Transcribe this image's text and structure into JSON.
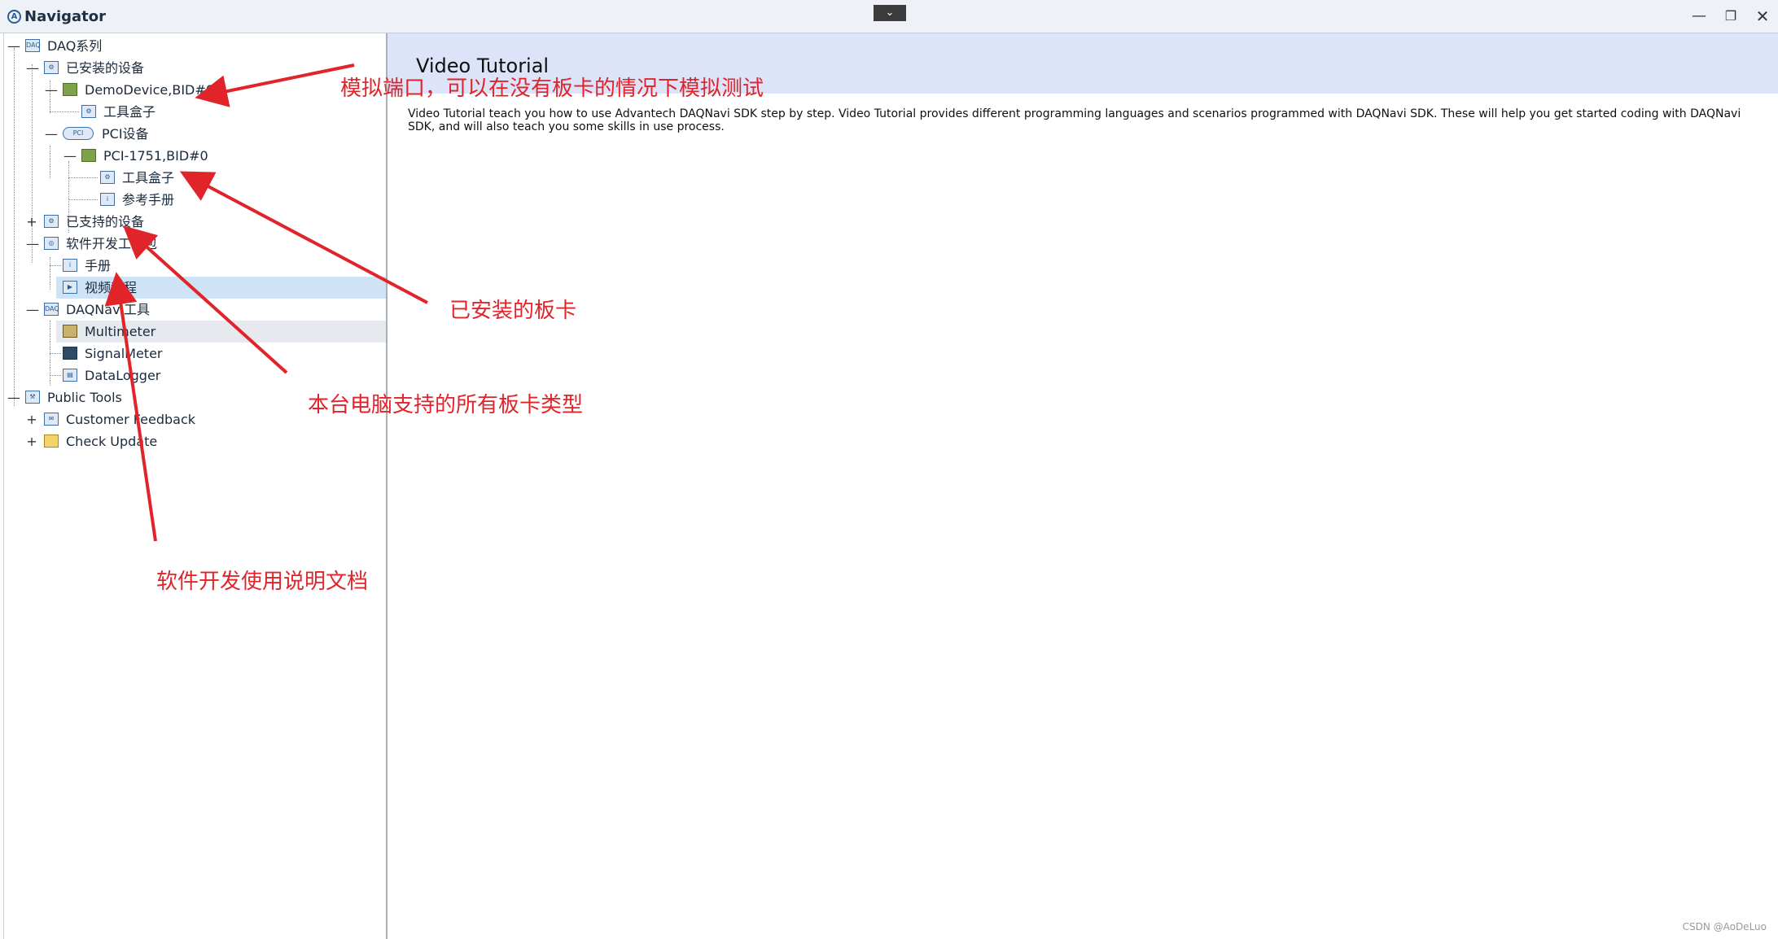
{
  "window": {
    "title": "Navigator",
    "collapse_icon": "chevron-down-icon",
    "minimize_symbol": "—",
    "maximize_symbol": "❐",
    "close_symbol": "✕"
  },
  "tree": {
    "daq_series": "DAQ系列",
    "installed_devices": "已安装的设备",
    "demo_device": "DemoDevice,BID#0",
    "demo_toolbox": "工具盒子",
    "pci_devices": "PCI设备",
    "pci_1751": "PCI-1751,BID#0",
    "pci_toolbox": "工具盒子",
    "pci_manual": "参考手册",
    "supported_devices": "已支持的设备",
    "sdk_tools": "软件开发工具包",
    "sdk_manual": "手册",
    "video_tutorial": "视频教程",
    "daqnavi_tools": "DAQNavi工具",
    "multimeter": "Multimeter",
    "signalmeter": "SignalMeter",
    "datalogger": "DataLogger",
    "public_tools": "Public Tools",
    "customer_feedback": "Customer Feedback",
    "check_update": "Check Update"
  },
  "content": {
    "title": "Video Tutorial",
    "description": "Video Tutorial teach you how to use Advantech DAQNavi SDK  step by step. Video Tutorial provides different programming languages and scenarios programmed with DAQNavi SDK. These will help you get started coding with DAQNavi SDK, and will also teach you some skills in use process."
  },
  "annotations": {
    "simulated_port": "模拟端口，可以在没有板卡的情况下模拟测试",
    "installed_board": "已安装的板卡",
    "supported_board_types": "本台电脑支持的所有板卡类型",
    "sdk_docs": "软件开发使用说明文档"
  },
  "watermark": "CSDN @AoDeLuo",
  "colors": {
    "annotation_red": "#e0242a",
    "header_band": "#dde3f8",
    "selected_row": "#cfe3f6"
  }
}
